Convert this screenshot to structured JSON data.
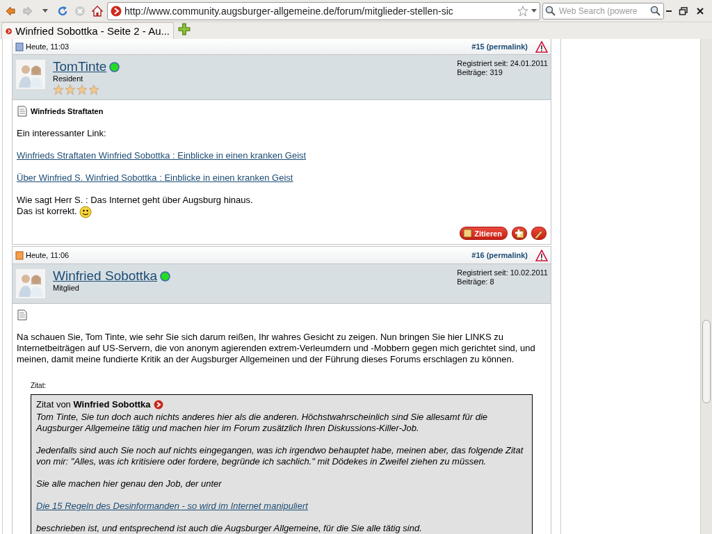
{
  "browser": {
    "url": "http://www.community.augsburger-allgemeine.de/forum/mitglieder-stellen-sic",
    "search_placeholder": "Web Search (powere",
    "tabs": [
      {
        "title": "Winfried Sobottka - Seite 2 - Au...",
        "selected": true
      }
    ]
  },
  "posts": [
    {
      "date": "Heute, 11:03",
      "unread": false,
      "number": "#15 (permalink)",
      "username": "TomTinte",
      "online": true,
      "rank": "Resident",
      "stars": 4,
      "registered": "Registriert seit: 24.01.2011",
      "post_count": "Beiträge: 319",
      "title": "Winfrieds Straftaten",
      "blocks": [
        {
          "kind": "text",
          "text": "Ein interessanter Link:"
        },
        {
          "kind": "link",
          "text": "Winfrieds Straftaten Winfried Sobottka : Einblicke in einen kranken Geist"
        },
        {
          "kind": "link",
          "text": "Über Winfried S. Winfried Sobottka : Einblicke in einen kranken Geist"
        },
        {
          "kind": "lines",
          "lines": [
            "Wie sagt Herr S. : Das Internet geht über Augsburg hinaus.",
            "Das ist korrekt."
          ],
          "smiley": true
        }
      ],
      "quote_button": "Zitieren"
    },
    {
      "date": "Heute, 11:06",
      "unread": true,
      "number": "#16 (permalink)",
      "username": "Winfried Sobottka",
      "online": true,
      "rank": "Mitglied",
      "registered": "Registriert seit: 10.02.2011",
      "post_count": "Beiträge: 8",
      "blocks": [
        {
          "kind": "text",
          "text": "Na schauen Sie, Tom Tinte, wie sehr Sie sich darum reißen, Ihr wahres Gesicht zu zeigen. Nun bringen Sie hier LINKS zu Internetbeiträgen auf US-Servern, die von anonym agierenden extrem-Verleumdern und -Mobbern gegen mich gerichtet sind, und meinen, damit meine fundierte Kritik an der Augsburger Allgemeinen und der Führung dieses Forums erschlagen zu können."
        },
        {
          "kind": "quote",
          "label": "Zitat:",
          "header": "Zitat von **Winfried Sobottka**",
          "blocks": [
            {
              "kind": "text",
              "text": "Tom Tinte, Sie tun doch auch nichts anderes hier als die anderen. Höchstwahrscheinlich sind Sie allesamt für die Augsburger Allgemeine tätig und machen hier im Forum zusätzlich Ihren Diskussions-Killer-Job."
            },
            {
              "kind": "text",
              "text": "Jedenfalls sind auch Sie noch auf nichts eingegangen, was ich irgendwo behauptet habe, meinen aber, das folgende Zitat von mir: \"Alles, was ich kritisiere oder fordere, begründe ich sachlich.\" mit Dödekes in Zweifel ziehen zu müssen."
            },
            {
              "kind": "text",
              "text": "Sie alle machen hier genau den Job, der unter"
            },
            {
              "kind": "link",
              "text": "Die 15 Regeln des Desinformanden - so wird im Internet manipuliert"
            },
            {
              "kind": "text",
              "text": "beschrieben ist, und entsprechend ist auch die Augsburger Allgemeine, für die Sie alle tätig sind."
            }
          ]
        }
      ]
    }
  ]
}
